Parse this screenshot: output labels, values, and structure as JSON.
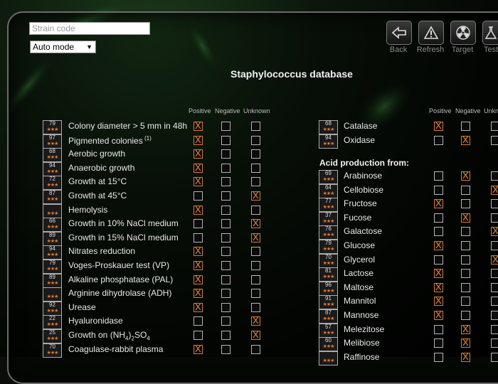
{
  "top": {
    "strain_placeholder": "Strain code",
    "mode_value": "Auto mode"
  },
  "toolbar": [
    {
      "label": "Back",
      "icon": "back-arrow-icon"
    },
    {
      "label": "Refresh",
      "icon": "warning-icon"
    },
    {
      "label": "Target",
      "icon": "biohazard-icon"
    },
    {
      "label": "Test",
      "icon": "flask-icon"
    }
  ],
  "page_title": "Staphylococcus database",
  "columns": {
    "positive": "Positive",
    "negative": "Negative",
    "unknown": "Unknown"
  },
  "acid_section_title": "Acid production from:",
  "left_tests": [
    {
      "num": "79",
      "label": "Colony diameter > 5 mm in 48h",
      "sup": "",
      "state": "pos"
    },
    {
      "num": "97",
      "label": "Pigmented colonies",
      "sup": "(1)",
      "state": "pos"
    },
    {
      "num": "68",
      "label": "Aerobic growth",
      "sup": "",
      "state": "pos"
    },
    {
      "num": "94",
      "label": "Anaerobic growth",
      "sup": "",
      "state": "pos"
    },
    {
      "num": "72",
      "label": "Growth at 15°C",
      "sup": "",
      "state": "pos"
    },
    {
      "num": "87",
      "label": "Growth at 45°C",
      "sup": "",
      "state": "unk"
    },
    {
      "num": "",
      "label": "Hemolysis",
      "sup": "",
      "state": "pos"
    },
    {
      "num": "66",
      "label": "Growth in 10% NaCl medium",
      "sup": "",
      "state": "unk"
    },
    {
      "num": "89",
      "label": "Growth in 15% NaCl medium",
      "sup": "",
      "state": "unk"
    },
    {
      "num": "94",
      "label": "Nitrates reduction",
      "sup": "",
      "state": "pos"
    },
    {
      "num": "79",
      "label": "Voges-Proskauer test (VP)",
      "sup": "",
      "state": "pos"
    },
    {
      "num": "89",
      "label": "Alkaline phosphatase (PAL)",
      "sup": "",
      "state": "pos"
    },
    {
      "num": "",
      "label": "Arginine dihydrolase (ADH)",
      "sup": "",
      "state": "pos"
    },
    {
      "num": "92",
      "label": "Urease",
      "sup": "",
      "state": "pos"
    },
    {
      "num": "22",
      "label": "Hyaluronidase",
      "sup": "",
      "state": "unk"
    },
    {
      "num": "25",
      "label": "Growth on (NH",
      "sub": "4",
      "label2": ")",
      "sub2": "2",
      "label3": "SO",
      "sub3": "4",
      "state": "unk"
    },
    {
      "num": "70",
      "label": "Coagulase-rabbit plasma",
      "sup": "",
      "state": "pos"
    }
  ],
  "right_tests_top": [
    {
      "num": "68",
      "label": "Catalase",
      "state": "pos"
    },
    {
      "num": "94",
      "label": "Oxidase",
      "state": "neg"
    }
  ],
  "right_tests_acid": [
    {
      "num": "69",
      "label": "Arabinose",
      "state": "neg"
    },
    {
      "num": "64",
      "label": "Cellobiose",
      "state": "unk"
    },
    {
      "num": "77",
      "label": "Fructose",
      "state": "pos"
    },
    {
      "num": "37",
      "label": "Fucose",
      "state": "neg"
    },
    {
      "num": "76",
      "label": "Galactose",
      "state": "unk"
    },
    {
      "num": "79",
      "label": "Glucose",
      "state": "pos"
    },
    {
      "num": "70",
      "label": "Glycerol",
      "state": "unk"
    },
    {
      "num": "81",
      "label": "Lactose",
      "state": "pos"
    },
    {
      "num": "96",
      "label": "Maltose",
      "state": "pos"
    },
    {
      "num": "91",
      "label": "Mannitol",
      "state": "pos"
    },
    {
      "num": "87",
      "label": "Mannose",
      "state": "pos"
    },
    {
      "num": "57",
      "label": "Melezitose",
      "state": "neg"
    },
    {
      "num": "60",
      "label": "Melibiose",
      "state": "neg"
    },
    {
      "num": "",
      "label": "Raffinose",
      "state": "neg"
    }
  ]
}
